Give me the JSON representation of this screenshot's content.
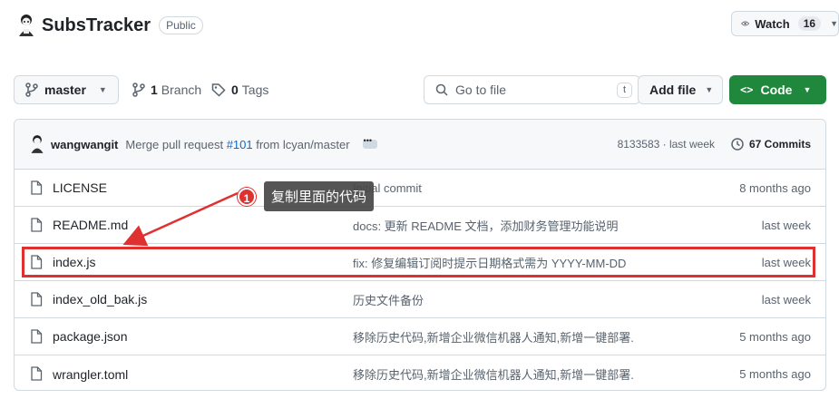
{
  "repo": {
    "name": "SubsTracker",
    "visibility": "Public"
  },
  "watch": {
    "label": "Watch",
    "count": "16"
  },
  "branch": {
    "name": "master"
  },
  "branches": {
    "count": "1",
    "label": "Branch"
  },
  "tags": {
    "count": "0",
    "label": "Tags"
  },
  "search": {
    "placeholder": "Go to file",
    "shortcut": "t"
  },
  "add_file": {
    "label": "Add file"
  },
  "code_btn": {
    "icon": "<>",
    "label": "Code"
  },
  "latest_commit": {
    "author": "wangwangit",
    "message_prefix": "Merge pull request",
    "pr": "#101",
    "message_suffix": "from lcyan/master",
    "sha": "8133583",
    "age": "· last week",
    "commits_count": "67 Commits"
  },
  "files": [
    {
      "name": "LICENSE",
      "message": "Initial commit",
      "age": "8 months ago"
    },
    {
      "name": "README.md",
      "message": "docs: 更新 README 文档，添加财务管理功能说明",
      "age": "last week"
    },
    {
      "name": "index.js",
      "message": "fix: 修复编辑订阅时提示日期格式需为 YYYY-MM-DD",
      "age": "last week"
    },
    {
      "name": "index_old_bak.js",
      "message": "历史文件备份",
      "age": "last week"
    },
    {
      "name": "package.json",
      "message": "移除历史代码,新增企业微信机器人通知,新增一键部署.",
      "age": "5 months ago"
    },
    {
      "name": "wrangler.toml",
      "message": "移除历史代码,新增企业微信机器人通知,新增一键部署.",
      "age": "5 months ago"
    }
  ],
  "annotation": {
    "number": "1",
    "text": "复制里面的代码",
    "color": "#e03131"
  },
  "colors": {
    "accent_green": "#1f883d",
    "link_blue": "#0969da",
    "highlight_red": "#e03131"
  }
}
